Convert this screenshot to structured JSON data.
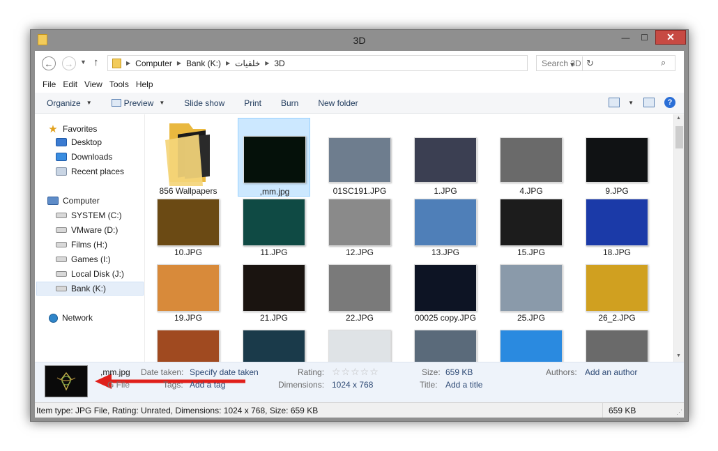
{
  "window": {
    "title": "3D",
    "close_glyph": "✕",
    "min_glyph": "—",
    "max_glyph": "☐"
  },
  "address": {
    "crumbs": [
      "Computer",
      "Bank (K:)",
      "خلفيات",
      "3D"
    ],
    "search_placeholder": "Search 3D"
  },
  "menu": [
    "File",
    "Edit",
    "View",
    "Tools",
    "Help"
  ],
  "toolbar": {
    "organize": "Organize",
    "preview": "Preview",
    "slideshow": "Slide show",
    "print": "Print",
    "burn": "Burn",
    "new_folder": "New folder"
  },
  "nav": {
    "favorites": "Favorites",
    "fav_items": [
      "Desktop",
      "Downloads",
      "Recent places"
    ],
    "computer": "Computer",
    "drives": [
      "SYSTEM (C:)",
      "VMware (D:)",
      "Films (H:)",
      "Games (I:)",
      "Local Disk (J:)",
      "Bank (K:)"
    ],
    "network": "Network"
  },
  "files": [
    {
      "name": "856 Wallpapers",
      "kind": "folder",
      "color": "#f2cb5a"
    },
    {
      "name": ",mm.jpg",
      "kind": "image",
      "color": "#05110a",
      "selected": true
    },
    {
      "name": "01SC191.JPG",
      "kind": "image",
      "color": "#6e7d8e"
    },
    {
      "name": "1.JPG",
      "kind": "image",
      "color": "#3b3f52"
    },
    {
      "name": "4.JPG",
      "kind": "image",
      "color": "#6a6a6a"
    },
    {
      "name": "9.JPG",
      "kind": "image",
      "color": "#101214"
    },
    {
      "name": "10.JPG",
      "kind": "image",
      "color": "#6b4a14"
    },
    {
      "name": "11.JPG",
      "kind": "image",
      "color": "#0f4a44"
    },
    {
      "name": "12.JPG",
      "kind": "image",
      "color": "#8a8a8a"
    },
    {
      "name": "13.JPG",
      "kind": "image",
      "color": "#4f7fb8"
    },
    {
      "name": "15.JPG",
      "kind": "image",
      "color": "#1c1c1c"
    },
    {
      "name": "18.JPG",
      "kind": "image",
      "color": "#1b3aa8"
    },
    {
      "name": "19.JPG",
      "kind": "image",
      "color": "#d88a3a"
    },
    {
      "name": "21.JPG",
      "kind": "image",
      "color": "#1a1410"
    },
    {
      "name": "22.JPG",
      "kind": "image",
      "color": "#7a7a7a"
    },
    {
      "name": "00025 copy.JPG",
      "kind": "image",
      "color": "#0d1424"
    },
    {
      "name": "25.JPG",
      "kind": "image",
      "color": "#8a9aaa"
    },
    {
      "name": "26_2.JPG",
      "kind": "image",
      "color": "#d0a020"
    },
    {
      "name": "",
      "kind": "image",
      "color": "#a04a20"
    },
    {
      "name": "",
      "kind": "image",
      "color": "#1a3a4a"
    },
    {
      "name": "",
      "kind": "image",
      "color": "#dfe3e6"
    },
    {
      "name": "",
      "kind": "image",
      "color": "#5a6a7a"
    },
    {
      "name": "",
      "kind": "image",
      "color": "#2a8ae0"
    },
    {
      "name": "",
      "kind": "image",
      "color": "#6a6a6a"
    }
  ],
  "details": {
    "name": ",mm.jpg",
    "type": "G File",
    "date_taken_label": "Date taken:",
    "date_taken_value": "Specify date taken",
    "tags_label": "Tags:",
    "tags_value": "Add a tag",
    "rating_label": "Rating:",
    "stars": "☆☆☆☆☆",
    "dimensions_label": "Dimensions:",
    "dimensions_value": "1024 x 768",
    "size_label": "Size:",
    "size_value": "659 KB",
    "title_label": "Title:",
    "title_value": "Add a title",
    "authors_label": "Authors:",
    "authors_value": "Add an author"
  },
  "status": {
    "left": "Item type: JPG File, Rating: Unrated, Dimensions: 1024 x 768, Size: 659 KB",
    "right": "659 KB"
  },
  "colors": {
    "accent": "#1e395b",
    "arrow": "#e0201b",
    "selection": "#cce8ff"
  }
}
